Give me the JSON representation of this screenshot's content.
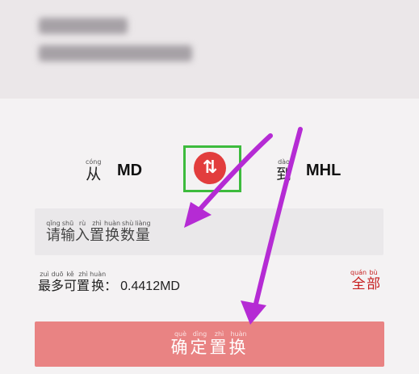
{
  "header": {
    "title_redacted": true
  },
  "converter": {
    "from_label": "从",
    "from_label_pinyin": "cóng",
    "from_code": "MD",
    "to_label": "到",
    "to_label_pinyin": "dào",
    "to_code": "MHL",
    "swap_symbol": "⇅"
  },
  "amount_input": {
    "placeholder": "请输入置换数量",
    "placeholder_pinyin": [
      "qǐng",
      "shū",
      "rù",
      "zhì",
      "huàn",
      "shù",
      "liàng"
    ],
    "value": ""
  },
  "max_info": {
    "label": "最多可置换：",
    "label_pinyin": [
      "zuì",
      "duō",
      "kě",
      "zhì",
      "huàn"
    ],
    "value": "0.4412MD"
  },
  "all_button": {
    "label": "全部",
    "label_pinyin": [
      "quán",
      "bù"
    ]
  },
  "confirm_button": {
    "label": "确定置换",
    "label_pinyin": [
      "què",
      "dìng",
      "zhì",
      "huàn"
    ]
  },
  "colors": {
    "accent_red": "#e23d3d",
    "highlight_green": "#3dbb3d",
    "arrow_purple": "#b52bd4",
    "confirm_bg": "#e98383"
  }
}
